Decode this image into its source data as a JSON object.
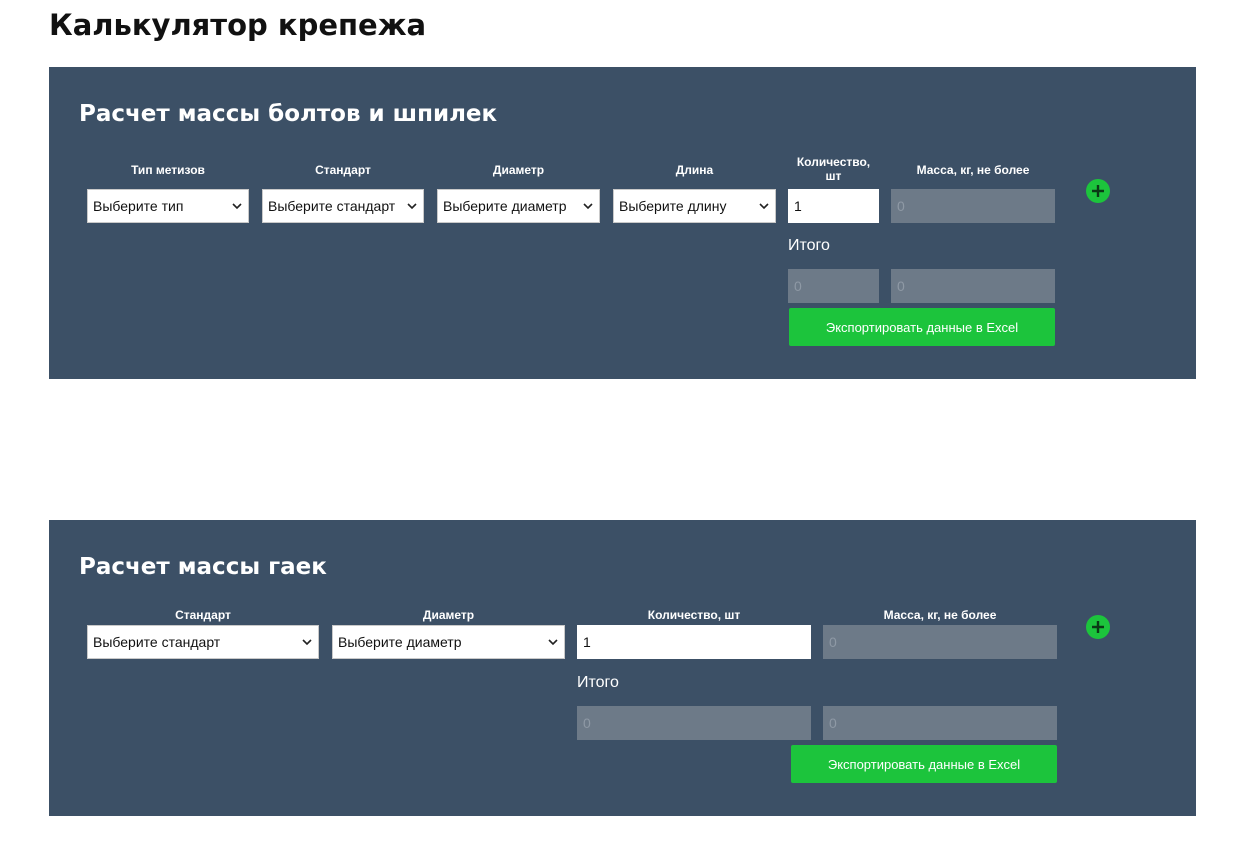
{
  "page_title": "Калькулятор крепежа",
  "bolts": {
    "title": "Расчет массы болтов и шпилек",
    "labels": {
      "type": "Тип метизов",
      "standard": "Стандарт",
      "diameter": "Диаметр",
      "length": "Длина",
      "quantity_line1": "Количество,",
      "quantity_line2": "шт",
      "mass": "Масса, кг, не более"
    },
    "selects": {
      "type": "Выберите тип",
      "standard": "Выберите стандарт",
      "diameter": "Выберите диаметр",
      "length": "Выберите длину"
    },
    "quantity_value": "1",
    "mass_value": "0",
    "total_label": "Итого",
    "total_quantity": "0",
    "total_mass": "0",
    "export_label": "Экспортировать данные в Excel"
  },
  "nuts": {
    "title": "Расчет массы гаек",
    "labels": {
      "standard": "Стандарт",
      "diameter": "Диаметр",
      "quantity": "Количество, шт",
      "mass": "Масса, кг, не более"
    },
    "selects": {
      "standard": "Выберите стандарт",
      "diameter": "Выберите диаметр"
    },
    "quantity_value": "1",
    "mass_value": "0",
    "total_label": "Итого",
    "total_quantity": "0",
    "total_mass": "0",
    "export_label": "Экспортировать данные в Excel"
  },
  "colors": {
    "panel_bg": "#3c5066",
    "accent_green": "#1cc43c",
    "readonly_field": "#6d7a88"
  },
  "icons": {
    "dropdown": "chevron-down-icon",
    "add": "plus-circle-icon"
  }
}
